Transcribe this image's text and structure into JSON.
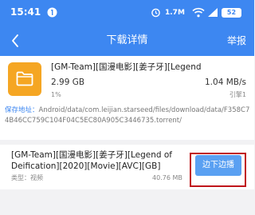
{
  "status_bar": {
    "time": "15:41",
    "net_speed": "1.7M",
    "battery": "52"
  },
  "header": {
    "back_icon": "chevron-left-icon",
    "title": "下载详情",
    "report_label": "举报"
  },
  "task": {
    "icon": "folder-icon",
    "name": "[GM-Team][国漫电影][姜子牙][Legend",
    "size": "2.99 GB",
    "speed": "1.04 MB/s",
    "percent": "1%",
    "peers": "引擎1",
    "path_label": "保存地址：",
    "path_value": "Android/data/com.leijian.starseed/files/download/data/F358C74B46CC759C104F04C5EC80A905C3446735.torrent/"
  },
  "file": {
    "name": "[GM-Team][国漫电影][姜子牙][Legend of Deification][2020][Movie][AVC][GB]",
    "type_text": "类型：视频",
    "size": "40.76 MB",
    "play_label": "边下边播"
  },
  "colors": {
    "accent": "#3d87f1",
    "button": "#5aa0f2",
    "folder": "#f5a623",
    "highlight": "#c0161b"
  }
}
